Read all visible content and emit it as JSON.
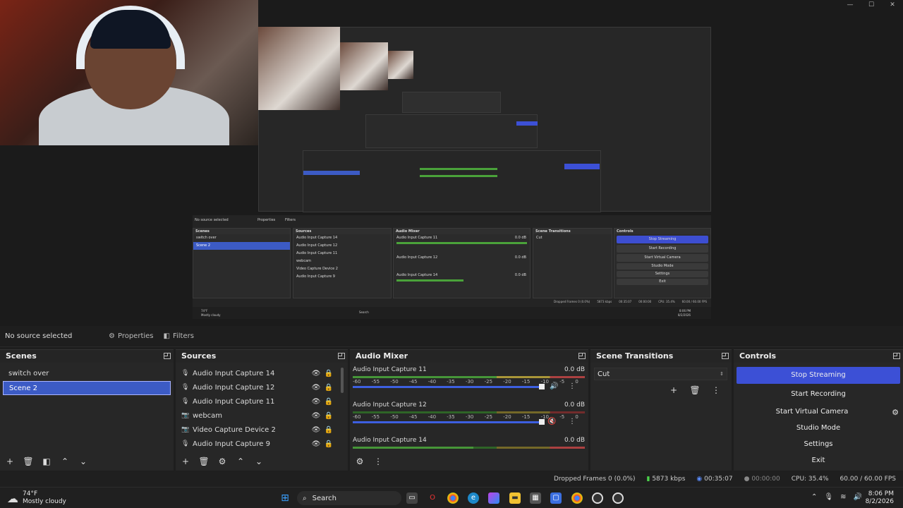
{
  "window": {
    "minimize": "—",
    "maximize": "☐",
    "close": "✕"
  },
  "source_toolbar": {
    "selection": "No source selected",
    "properties": "Properties",
    "filters": "Filters"
  },
  "scenes": {
    "title": "Scenes",
    "items": [
      "switch over",
      "Scene 2"
    ],
    "selected": 1
  },
  "sources": {
    "title": "Sources",
    "items": [
      {
        "name": "Audio Input Capture 14",
        "icon": "microphone-icon"
      },
      {
        "name": "Audio Input Capture 12",
        "icon": "microphone-icon"
      },
      {
        "name": "Audio Input Capture 11",
        "icon": "microphone-icon"
      },
      {
        "name": "webcam",
        "icon": "camera-icon"
      },
      {
        "name": "Video Capture Device 2",
        "icon": "camera-icon"
      },
      {
        "name": "Audio Input Capture 9",
        "icon": "microphone-icon"
      }
    ]
  },
  "audio_mixer": {
    "title": "Audio Mixer",
    "ticks": [
      "-60",
      "-55",
      "-50",
      "-45",
      "-40",
      "-35",
      "-30",
      "-25",
      "-20",
      "-15",
      "-10",
      "-5",
      "0"
    ],
    "channels": [
      {
        "name": "Audio Input Capture 11",
        "level": "0.0 dB"
      },
      {
        "name": "Audio Input Capture 12",
        "level": "0.0 dB"
      },
      {
        "name": "Audio Input Capture 14",
        "level": "0.0 dB"
      }
    ]
  },
  "scene_transitions": {
    "title": "Scene Transitions",
    "selected": "Cut"
  },
  "controls": {
    "title": "Controls",
    "stop_streaming": "Stop Streaming",
    "start_recording": "Start Recording",
    "start_virtual_camera": "Start Virtual Camera",
    "studio_mode": "Studio Mode",
    "settings": "Settings",
    "exit": "Exit"
  },
  "status": {
    "dropped_frames": "Dropped Frames 0 (0.0%)",
    "bitrate": "5873 kbps",
    "stream_time": "00:35:07",
    "record_time": "00:00:00",
    "cpu": "CPU: 35.4%",
    "fps": "60.00 / 60.00 FPS"
  },
  "taskbar": {
    "weather_temp": "74°F",
    "weather_desc": "Mostly cloudy",
    "search": "Search",
    "time": "8:06 PM",
    "date": "8/2/2026"
  },
  "inner_preview": {
    "selection": "No source selected",
    "properties": "Properties",
    "filters": "Filters",
    "scenes_title": "Scenes",
    "scenes": [
      "switch over",
      "Scene 2"
    ],
    "sources_title": "Sources",
    "sources": [
      "Audio Input Capture 14",
      "Audio Input Capture 12",
      "Audio Input Capture 11",
      "webcam",
      "Video Capture Device 2",
      "Audio Input Capture 9"
    ],
    "mixer_title": "Audio Mixer",
    "mixer": [
      "Audio Input Capture 11",
      "Audio Input Capture 12",
      "Audio Input Capture 14"
    ],
    "mixer_level": "0.0 dB",
    "transitions_title": "Scene Transitions",
    "transition": "Cut",
    "controls_title": "Controls",
    "controls": [
      "Stop Streaming",
      "Start Recording",
      "Start Virtual Camera",
      "Studio Mode",
      "Settings",
      "Exit"
    ],
    "status": [
      "Dropped Frames 0 (0.0%)",
      "5873 kbps",
      "00:35:07",
      "00:00:00",
      "CPU: 35.4%",
      "60.00 / 60.00 FPS"
    ],
    "weather_temp": "74°F",
    "weather_desc": "Mostly cloudy",
    "search": "Search",
    "time": "8:06 PM",
    "date": "8/2/2026"
  }
}
